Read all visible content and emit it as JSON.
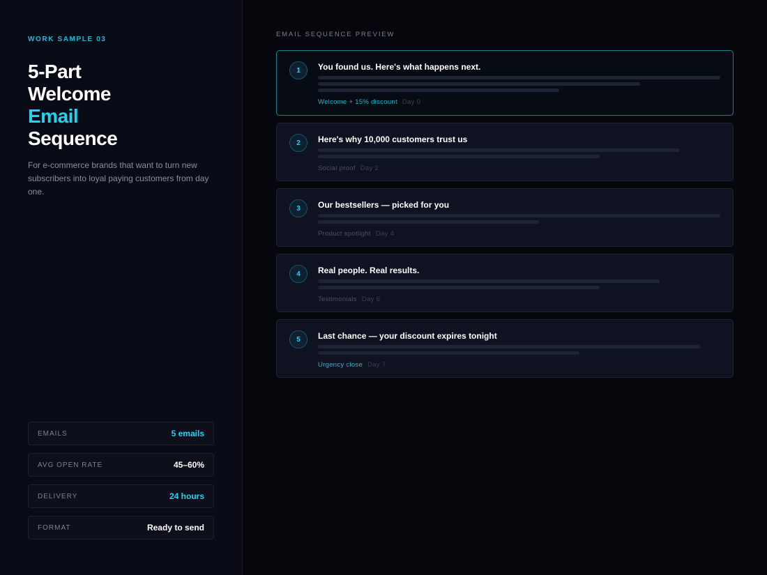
{
  "eyebrow": "WORK SAMPLE 03",
  "title": {
    "line1": "5-Part",
    "line2": "Welcome",
    "line3": "Email",
    "line4": "Sequence"
  },
  "description": "For e-commerce brands that want to turn new subscribers into loyal paying customers from day one.",
  "stats": [
    {
      "label": "EMAILS",
      "value": "5 emails",
      "accent": true
    },
    {
      "label": "AVG OPEN RATE",
      "value": "45–60%",
      "accent": false
    },
    {
      "label": "DELIVERY",
      "value": "24 hours",
      "accent": true
    },
    {
      "label": "FORMAT",
      "value": "Ready to send",
      "accent": false
    }
  ],
  "preview_label": "EMAIL SEQUENCE PREVIEW",
  "emails": [
    {
      "number": "1",
      "title": "You found us. Here's what happens next.",
      "tag": "Welcome + 15% discount",
      "day": "Day 0",
      "highlight": true
    },
    {
      "number": "2",
      "title": "Here's why 10,000 customers trust us",
      "tag": "Social proof",
      "day": "Day 2",
      "highlight": false
    },
    {
      "number": "3",
      "title": "Our bestsellers — picked for you",
      "tag": "Product spotlight",
      "day": "Day 4",
      "highlight": false
    },
    {
      "number": "4",
      "title": "Real people. Real results.",
      "tag": "Testimonials",
      "day": "Day 6",
      "highlight": false
    },
    {
      "number": "5",
      "title": "Last chance — your discount expires tonight",
      "tag": "Urgency close",
      "day": "Day 7",
      "highlight": true
    }
  ],
  "colors": {
    "accent": "#22d3ee",
    "background": "#06070d",
    "panel": "#090c17",
    "card": "#0e1221"
  }
}
